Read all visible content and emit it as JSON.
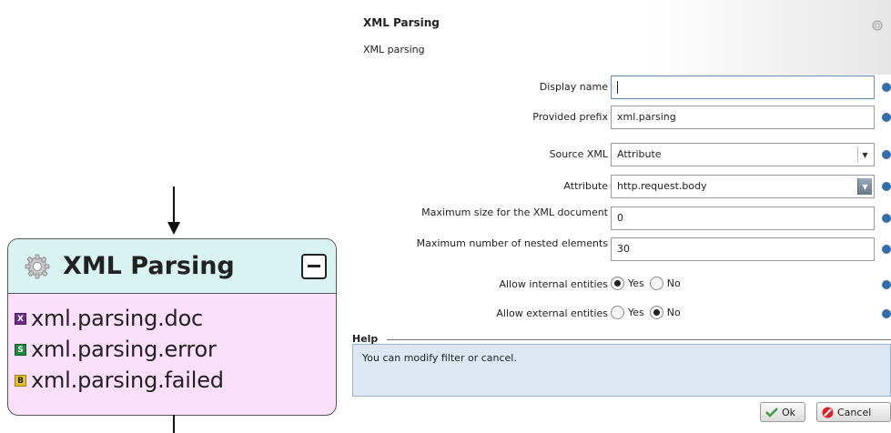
{
  "node": {
    "title": "XML Parsing",
    "icon": "gear-icon",
    "outputs": [
      {
        "badge": "X",
        "label": "xml.parsing.doc",
        "color": "#6b2e8a"
      },
      {
        "badge": "S",
        "label": "xml.parsing.error",
        "color": "#1f8a3a"
      },
      {
        "badge": "B",
        "label": "xml.parsing.failed",
        "color": "#e7c128"
      }
    ]
  },
  "panel": {
    "title": "XML Parsing",
    "subtitle": "XML parsing",
    "fields": {
      "display_name": {
        "label": "Display name",
        "value": ""
      },
      "provided_prefix": {
        "label": "Provided prefix",
        "value": "xml.parsing"
      },
      "source_xml": {
        "label": "Source XML",
        "value": "Attribute"
      },
      "attribute": {
        "label": "Attribute",
        "value": "http.request.body"
      },
      "max_size": {
        "label": "Maximum size for the XML document",
        "value": "0"
      },
      "max_nested": {
        "label": "Maximum number of nested elements",
        "value": "30"
      },
      "allow_internal": {
        "label": "Allow internal entities",
        "yes": "Yes",
        "no": "No",
        "selected": "Yes"
      },
      "allow_external": {
        "label": "Allow external entities",
        "yes": "Yes",
        "no": "No",
        "selected": "No"
      }
    },
    "help": {
      "title": "Help",
      "text": "You can modify filter or cancel."
    },
    "buttons": {
      "ok": "Ok",
      "cancel": "Cancel"
    }
  }
}
